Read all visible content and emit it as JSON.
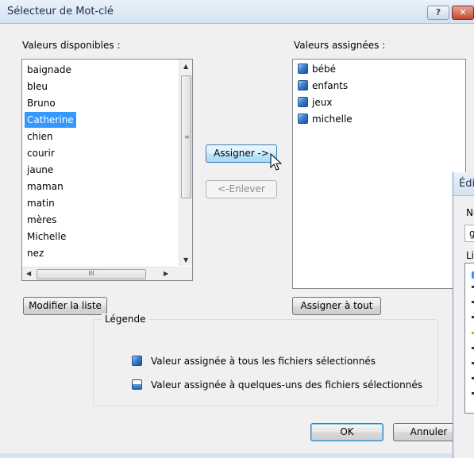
{
  "dialog": {
    "title": "Sélecteur de Mot-clé",
    "help_glyph": "?",
    "close_glyph": "✕"
  },
  "available": {
    "label": "Valeurs disponibles :",
    "items": [
      "baignade",
      "bleu",
      "Bruno",
      "Catherine",
      "chien",
      "courir",
      "jaune",
      "maman",
      "matin",
      "mères",
      "Michelle",
      "nez"
    ],
    "selected": "Catherine",
    "hscroll_grip": "III"
  },
  "assigned": {
    "label": "Valeurs assignées :",
    "items": [
      "bébé",
      "enfants",
      "jeux",
      "michelle"
    ]
  },
  "buttons": {
    "assign": "Assigner ->",
    "remove": "<-Enlever",
    "modify_list": "Modifier la liste",
    "assign_all": "Assigner à tout",
    "ok": "OK",
    "cancel": "Annuler"
  },
  "legend": {
    "title": "Légende",
    "all_files": "Valeur assignée à tous les fichiers sélectionnés",
    "some_files": "Valeur assignée à quelques-uns des fichiers sélectionnés"
  },
  "background_window": {
    "title_fragment": "Édi",
    "label1_fragment": "No",
    "field_fragment": "g",
    "label2_fragment": "Lis"
  },
  "colors": {
    "selection": "#3399ff",
    "dialog_bg": "#f0f0f0",
    "close_button": "#c5472e"
  },
  "icons": {
    "keyword_full": "keyword-assigned-all-icon",
    "keyword_partial": "keyword-assigned-some-icon",
    "cursor": "mouse-pointer-icon"
  }
}
